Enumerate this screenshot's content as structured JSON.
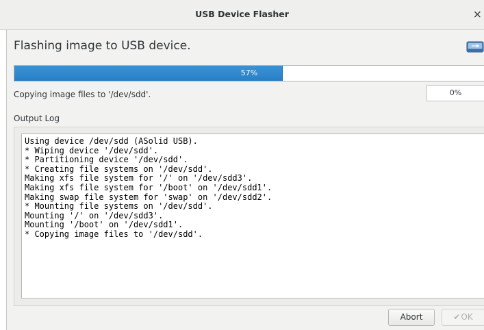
{
  "window": {
    "title": "USB Device Flasher",
    "close_glyph": "×"
  },
  "header": {
    "heading": "Flashing image to USB device.",
    "icon": "usb-drive-icon"
  },
  "main_progress": {
    "value": 0.57,
    "label": "57%",
    "fill_color": "#2a84c8"
  },
  "status": {
    "text": "Copying image files to '/dev/sdd'.",
    "sub_progress_label": "0%"
  },
  "log": {
    "label": "Output Log",
    "lines": [
      "Using device /dev/sdd (ASolid USB).",
      "* Wiping device '/dev/sdd'.",
      "* Partitioning device '/dev/sdd'.",
      "* Creating file systems on '/dev/sdd'.",
      "Making xfs file system for '/' on '/dev/sdd3'.",
      "Making xfs file system for '/boot' on '/dev/sdd1'.",
      "Making swap file system for 'swap' on '/dev/sdd2'.",
      "* Mounting file systems on '/dev/sdd'.",
      "Mounting '/' on '/dev/sdd3'.",
      "Mounting '/boot' on '/dev/sdd1'.",
      "* Copying image files to '/dev/sdd'."
    ]
  },
  "buttons": {
    "abort_label": "Abort",
    "ok_label": "OK",
    "ok_icon": "check-icon",
    "ok_enabled": false
  }
}
